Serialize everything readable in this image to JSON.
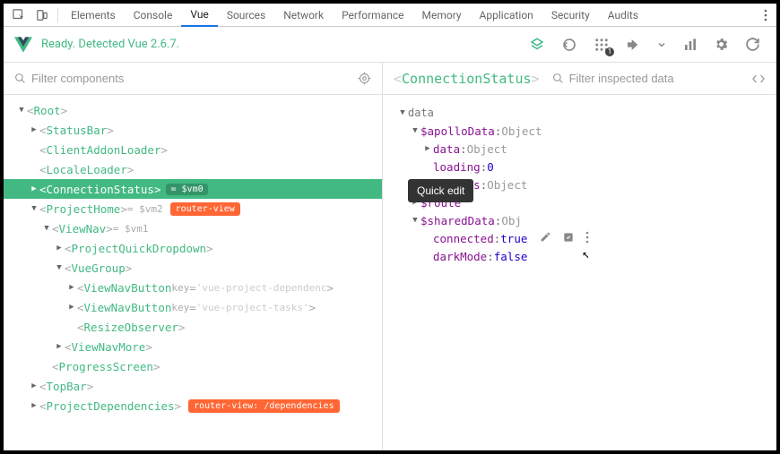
{
  "devtools": {
    "tabs": [
      "Elements",
      "Console",
      "Vue",
      "Sources",
      "Network",
      "Performance",
      "Memory",
      "Application",
      "Security",
      "Audits"
    ],
    "active_tab": "Vue"
  },
  "vue_header": {
    "status": "Ready. Detected Vue 2.6.7.",
    "icons": {
      "components": "components",
      "vuex": "vuex",
      "events": "events",
      "events_badge": "1",
      "routing": "routing",
      "chevron": "chevron-down",
      "perf": "perf",
      "settings": "settings",
      "refresh": "refresh"
    }
  },
  "filter_left": {
    "placeholder": "Filter components"
  },
  "filter_right": {
    "placeholder": "Filter inspected data"
  },
  "inspector": {
    "title": "ConnectionStatus"
  },
  "tree": [
    {
      "depth": 0,
      "arrow": "down",
      "name": "Root"
    },
    {
      "depth": 1,
      "arrow": "right",
      "name": "StatusBar"
    },
    {
      "depth": 1,
      "arrow": "none",
      "name": "ClientAddonLoader"
    },
    {
      "depth": 1,
      "arrow": "none",
      "name": "LocaleLoader"
    },
    {
      "depth": 1,
      "arrow": "right",
      "name": "ConnectionStatus",
      "selected": true,
      "suffix": " = $vm0"
    },
    {
      "depth": 1,
      "arrow": "down",
      "name": "ProjectHome",
      "suffix": " = $vm2",
      "badge": "router-view",
      "badgeType": "orange"
    },
    {
      "depth": 2,
      "arrow": "down",
      "name": "ViewNav",
      "suffix": " = $vm1"
    },
    {
      "depth": 3,
      "arrow": "right",
      "name": "ProjectQuickDropdown"
    },
    {
      "depth": 3,
      "arrow": "down",
      "name": "VueGroup"
    },
    {
      "depth": 4,
      "arrow": "right",
      "name": "ViewNavButton",
      "attr": "key",
      "attrval": "'vue-project-dependenc"
    },
    {
      "depth": 4,
      "arrow": "right",
      "name": "ViewNavButton",
      "attr": "key",
      "attrval": "'vue-project-tasks'",
      "close": true
    },
    {
      "depth": 4,
      "arrow": "none",
      "name": "ResizeObserver"
    },
    {
      "depth": 3,
      "arrow": "right",
      "name": "ViewNavMore"
    },
    {
      "depth": 2,
      "arrow": "none",
      "name": "ProgressScreen"
    },
    {
      "depth": 1,
      "arrow": "right",
      "name": "TopBar"
    },
    {
      "depth": 1,
      "arrow": "right",
      "name": "ProjectDependencies",
      "badge": "router-view: /dependencies",
      "badgeType": "orange"
    }
  ],
  "data_panel": {
    "root": "data",
    "rows": [
      {
        "depth": 1,
        "arrow": "down",
        "key": "$apolloData",
        "val": "Object",
        "valtype": "obj"
      },
      {
        "depth": 2,
        "arrow": "right",
        "key": "data",
        "val": "Object",
        "valtype": "obj"
      },
      {
        "depth": 2,
        "arrow": "none",
        "key": "loading",
        "val": "0",
        "valtype": "num"
      },
      {
        "depth": 2,
        "arrow": "right",
        "key": "queries",
        "val": "Object",
        "valtype": "obj"
      },
      {
        "depth": 1,
        "arrow": "right",
        "key": "$route",
        "val": "",
        "valtype": "obj"
      },
      {
        "depth": 1,
        "arrow": "down",
        "key": "$sharedData",
        "val": "Obj",
        "valtype": "obj",
        "tooltip": "Quick edit"
      },
      {
        "depth": 2,
        "arrow": "none",
        "key": "connected",
        "val": "true",
        "valtype": "bool",
        "actions": true
      },
      {
        "depth": 2,
        "arrow": "none",
        "key": "darkMode",
        "val": "false",
        "valtype": "bool"
      }
    ]
  }
}
